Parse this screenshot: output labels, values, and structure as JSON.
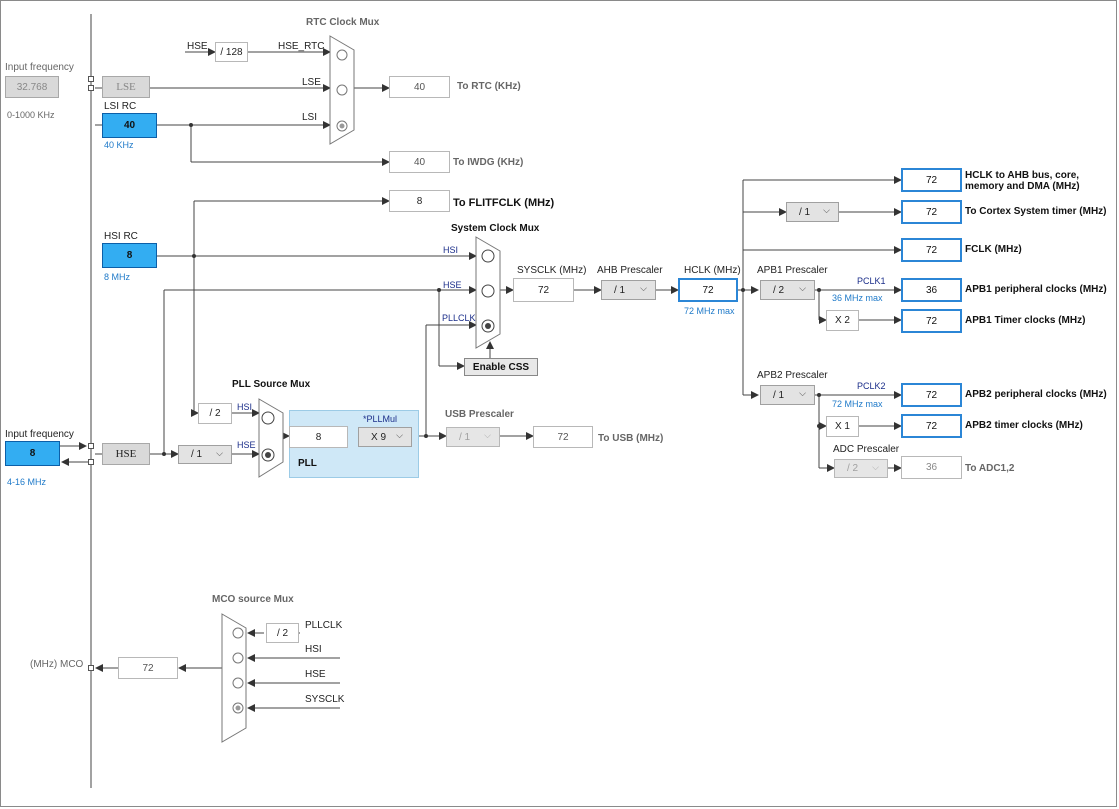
{
  "left_panel": {
    "lse_input": {
      "label": "Input frequency",
      "value": "32.768",
      "range": "0-1000 KHz"
    },
    "lsi_rc": {
      "label": "LSI RC",
      "value": "40",
      "freq": "40 KHz"
    },
    "hsi_rc": {
      "label": "HSI RC",
      "value": "8",
      "freq": "8 MHz"
    },
    "hse_input": {
      "label": "Input frequency",
      "value": "8",
      "range": "4-16 MHz"
    },
    "mco": {
      "label": "(MHz) MCO",
      "value": "72"
    }
  },
  "rtc_mux": {
    "title": "RTC Clock Mux",
    "hse_label": "HSE",
    "div128": "/ 128",
    "hse_rtc": "HSE_RTC",
    "lse_block": "LSE",
    "lse_label": "LSE",
    "lsi_label": "LSI",
    "rtc_value": "40",
    "rtc_label": "To RTC (KHz)",
    "iwdg_value": "40",
    "iwdg_label": "To IWDG (KHz)",
    "flit_value": "8",
    "flit_label": "To FLITFCLK (MHz)"
  },
  "sys_mux": {
    "title": "System Clock Mux",
    "hsi": "HSI",
    "hse": "HSE",
    "pllclk": "PLLCLK",
    "css_button": "Enable CSS"
  },
  "sysclk": {
    "label": "SYSCLK (MHz)",
    "value": "72"
  },
  "ahb": {
    "label": "AHB Prescaler",
    "value": "/ 1"
  },
  "hclk": {
    "label": "HCLK (MHz)",
    "value": "72",
    "max": "72 MHz max"
  },
  "apb1": {
    "label": "APB1 Prescaler",
    "value": "/ 2",
    "pclk": "PCLK1",
    "max": "36 MHz max",
    "timer_mult": "X 2"
  },
  "apb2": {
    "label": "APB2 Prescaler",
    "value": "/ 1",
    "pclk": "PCLK2",
    "max": "72 MHz max",
    "timer_mult": "X 1"
  },
  "adc": {
    "label": "ADC Prescaler",
    "value": "/ 2",
    "out": "36",
    "out_label": "To ADC1,2"
  },
  "cortex_prescaler": "/ 1",
  "outputs": [
    {
      "value": "72",
      "label": "HCLK to AHB bus, core,",
      "label2": "memory and DMA (MHz)"
    },
    {
      "value": "72",
      "label": "To Cortex System timer (MHz)"
    },
    {
      "value": "72",
      "label": "FCLK (MHz)"
    },
    {
      "value": "36",
      "label": "APB1 peripheral clocks (MHz)"
    },
    {
      "value": "72",
      "label": "APB1 Timer clocks (MHz)"
    },
    {
      "value": "72",
      "label": "APB2 peripheral clocks (MHz)"
    },
    {
      "value": "72",
      "label": "APB2 timer clocks (MHz)"
    }
  ],
  "pll_src": {
    "title": "PLL Source Mux",
    "hsi_div": "/ 2",
    "hsi": "HSI",
    "hse": "HSE",
    "hse_block": "HSE",
    "hse_div": "/ 1"
  },
  "pll": {
    "label": "PLL",
    "in_value": "8",
    "mul_label": "*PLLMul",
    "mul_value": "X 9"
  },
  "usb": {
    "label": "USB Prescaler",
    "value": "/ 1",
    "out": "72",
    "out_label": "To USB (MHz)"
  },
  "mco_mux": {
    "title": "MCO source Mux",
    "div": "/ 2",
    "pllclk": "PLLCLK",
    "hsi": "HSI",
    "hse": "HSE",
    "sysclk": "SYSCLK"
  },
  "chevron": "⌵"
}
